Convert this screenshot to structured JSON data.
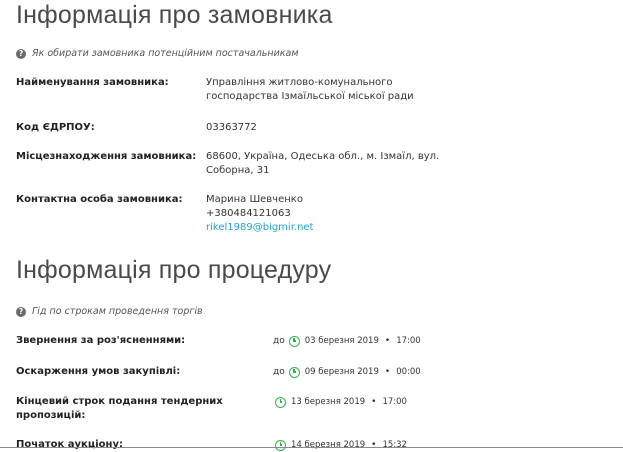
{
  "customer_section": {
    "title": "Інформація про замовника",
    "help_link": "Як обирати замовника потенційним постачальникам",
    "rows": [
      {
        "label": "Найменування замовника:",
        "lines": [
          "Управління житлово-комунального",
          "господарства Ізмаїльської міської ради"
        ]
      },
      {
        "label": "Код ЄДРПОУ:",
        "lines": [
          "03363772"
        ]
      },
      {
        "label": "Місцезнаходження замовника:",
        "lines": [
          "68600, Україна, Одеська обл., м. Ізмаїл, вул.",
          "Соборна, 31"
        ]
      },
      {
        "label": "Контактна особа замовника:",
        "lines": [
          "Марина Шевченко",
          "+380484121063"
        ],
        "email": "rikel1989@bigmir.net"
      }
    ]
  },
  "procedure_section": {
    "title": "Інформація про процедуру",
    "help_link": "Гід по строкам проведення торгів",
    "rows": [
      {
        "label": "Звернення за роз'ясненнями:",
        "prefix": "до",
        "date": "03 березня 2019",
        "time": "17:00"
      },
      {
        "label": "Оскарження умов закупівлі:",
        "prefix": "до",
        "date": "09 березня 2019",
        "time": "00:00"
      },
      {
        "label_lines": [
          "Кінцевий строк подання тендерних",
          "пропозицій:"
        ],
        "prefix": "",
        "date": "13 березня 2019",
        "time": "17:00"
      },
      {
        "label": "Початок аукціону:",
        "prefix": "",
        "date": "14 березня 2019",
        "time": "15:32"
      }
    ]
  },
  "colors": {
    "accent_green": "#35b34a",
    "link_blue": "#1fa3d8"
  },
  "icons": {
    "help": "question-circle-icon",
    "clock": "clock-icon"
  }
}
